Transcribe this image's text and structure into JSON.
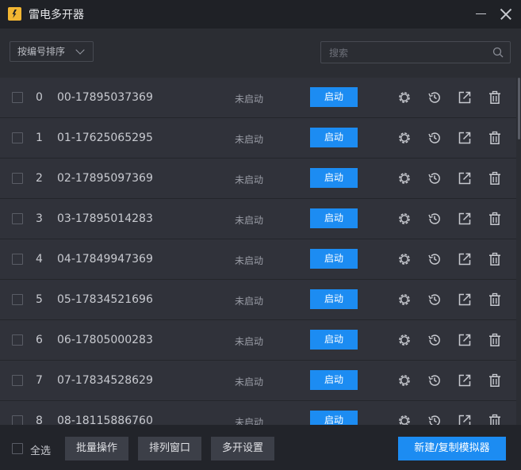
{
  "app": {
    "title": "雷电多开器"
  },
  "toolbar": {
    "sort_label": "按编号排序",
    "search_placeholder": "搜索"
  },
  "list": {
    "start_label": "启动",
    "rows": [
      {
        "index": "0",
        "name": "00-17895037369",
        "status": "未启动"
      },
      {
        "index": "1",
        "name": "01-17625065295",
        "status": "未启动"
      },
      {
        "index": "2",
        "name": "02-17895097369",
        "status": "未启动"
      },
      {
        "index": "3",
        "name": "03-17895014283",
        "status": "未启动"
      },
      {
        "index": "4",
        "name": "04-17849947369",
        "status": "未启动"
      },
      {
        "index": "5",
        "name": "05-17834521696",
        "status": "未启动"
      },
      {
        "index": "6",
        "name": "06-17805000283",
        "status": "未启动"
      },
      {
        "index": "7",
        "name": "07-17834528629",
        "status": "未启动"
      },
      {
        "index": "8",
        "name": "08-18115886760",
        "status": "未启动"
      }
    ],
    "row_icons": [
      "gear-icon",
      "history-icon",
      "export-icon",
      "trash-icon"
    ]
  },
  "footer": {
    "select_all": "全选",
    "batch": "批量操作",
    "arrange": "排列窗口",
    "multi_settings": "多开设置",
    "new_copy": "新建/复制模拟器"
  },
  "colors": {
    "accent": "#1c8cf2",
    "background": "#2b2d33",
    "titlebar": "#1f2126",
    "logo": "#f2b632"
  }
}
